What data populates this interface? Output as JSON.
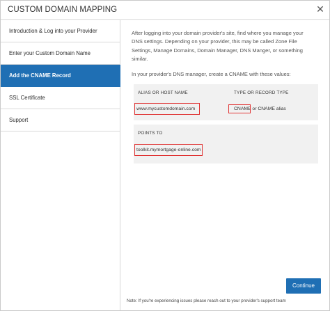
{
  "dialog": {
    "title": "CUSTOM DOMAIN MAPPING",
    "close_icon": "close-icon"
  },
  "sidebar": {
    "items": [
      {
        "label": "Introduction & Log into your Provider",
        "active": false
      },
      {
        "label": "Enter your Custom Domain Name",
        "active": false
      },
      {
        "label": "Add the CNAME Record",
        "active": true
      },
      {
        "label": "SSL Certificate",
        "active": false
      },
      {
        "label": "Support",
        "active": false
      }
    ]
  },
  "content": {
    "intro_lines": [
      "After logging into your domain provider's site, find where you manage your",
      "DNS settings. Depending on your provider, this may be called Zone File",
      "Settings, Manage Domains, Domain Manager, DNS Manger, or something",
      "similar."
    ],
    "instruction": "In your provider's DNS manager, create a CNAME with these values:",
    "table": {
      "alias_header": "ALIAS OR HOST NAME",
      "type_header": "TYPE OR RECORD TYPE",
      "alias_value": "www.mycustomdomain.com",
      "type_value": "CNAME",
      "type_suffix": " or CNAME alias",
      "points_header": "POINTS TO",
      "points_value": "toolkit.mymortgage-online.com"
    }
  },
  "footer": {
    "continue_label": "Continue",
    "note": "Note: If you're experiencing issues please reach out to your provider's support team"
  },
  "colors": {
    "accent": "#1f6fb4",
    "highlight": "#e03434"
  }
}
